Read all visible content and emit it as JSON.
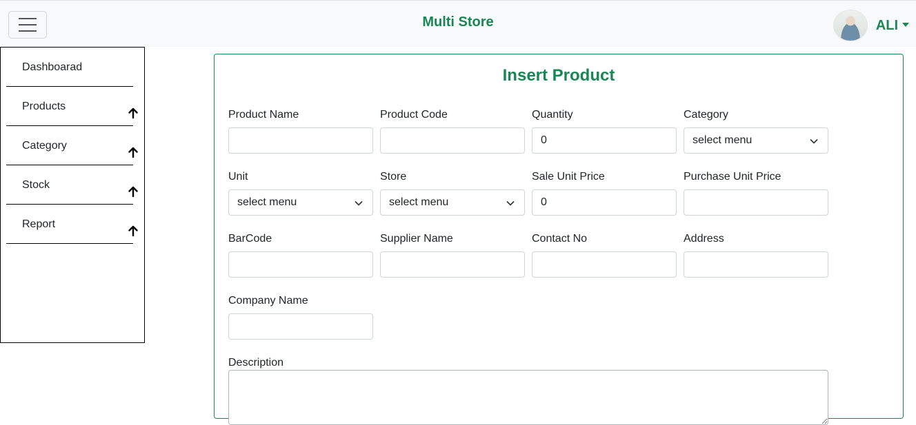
{
  "header": {
    "brand": "Multi Store",
    "user_name": "ALI"
  },
  "sidebar": {
    "items": [
      {
        "label": "Dashboarad"
      },
      {
        "label": "Products"
      },
      {
        "label": "Category"
      },
      {
        "label": "Stock"
      },
      {
        "label": "Report"
      }
    ]
  },
  "form": {
    "title": "Insert Product",
    "fields": {
      "product_name": {
        "label": "Product Name",
        "value": ""
      },
      "product_code": {
        "label": "Product Code",
        "value": ""
      },
      "quantity": {
        "label": "Quantity",
        "value": "0"
      },
      "category": {
        "label": "Category",
        "selected": "select menu"
      },
      "unit": {
        "label": "Unit",
        "selected": "select menu"
      },
      "store": {
        "label": "Store",
        "selected": "select menu"
      },
      "sale_unit_price": {
        "label": "Sale Unit Price",
        "value": "0"
      },
      "purchase_unit_price": {
        "label": "Purchase Unit Price",
        "value": ""
      },
      "barcode": {
        "label": "BarCode",
        "value": ""
      },
      "supplier_name": {
        "label": "Supplier Name",
        "value": ""
      },
      "contact_no": {
        "label": "Contact No",
        "value": ""
      },
      "address": {
        "label": "Address",
        "value": ""
      },
      "company_name": {
        "label": "Company Name",
        "value": ""
      },
      "description": {
        "label": "Description",
        "value": ""
      }
    }
  },
  "icons": {
    "menu": "hamburger-icon",
    "avatar": "user-avatar",
    "caret": "caret-down-icon",
    "sidebar_arrow": "arrow-up-icon",
    "select_chevron": "chevron-down-icon"
  },
  "colors": {
    "accent": "#198754",
    "topbar_bg": "#f8f9fa",
    "border": "#ced4da"
  }
}
